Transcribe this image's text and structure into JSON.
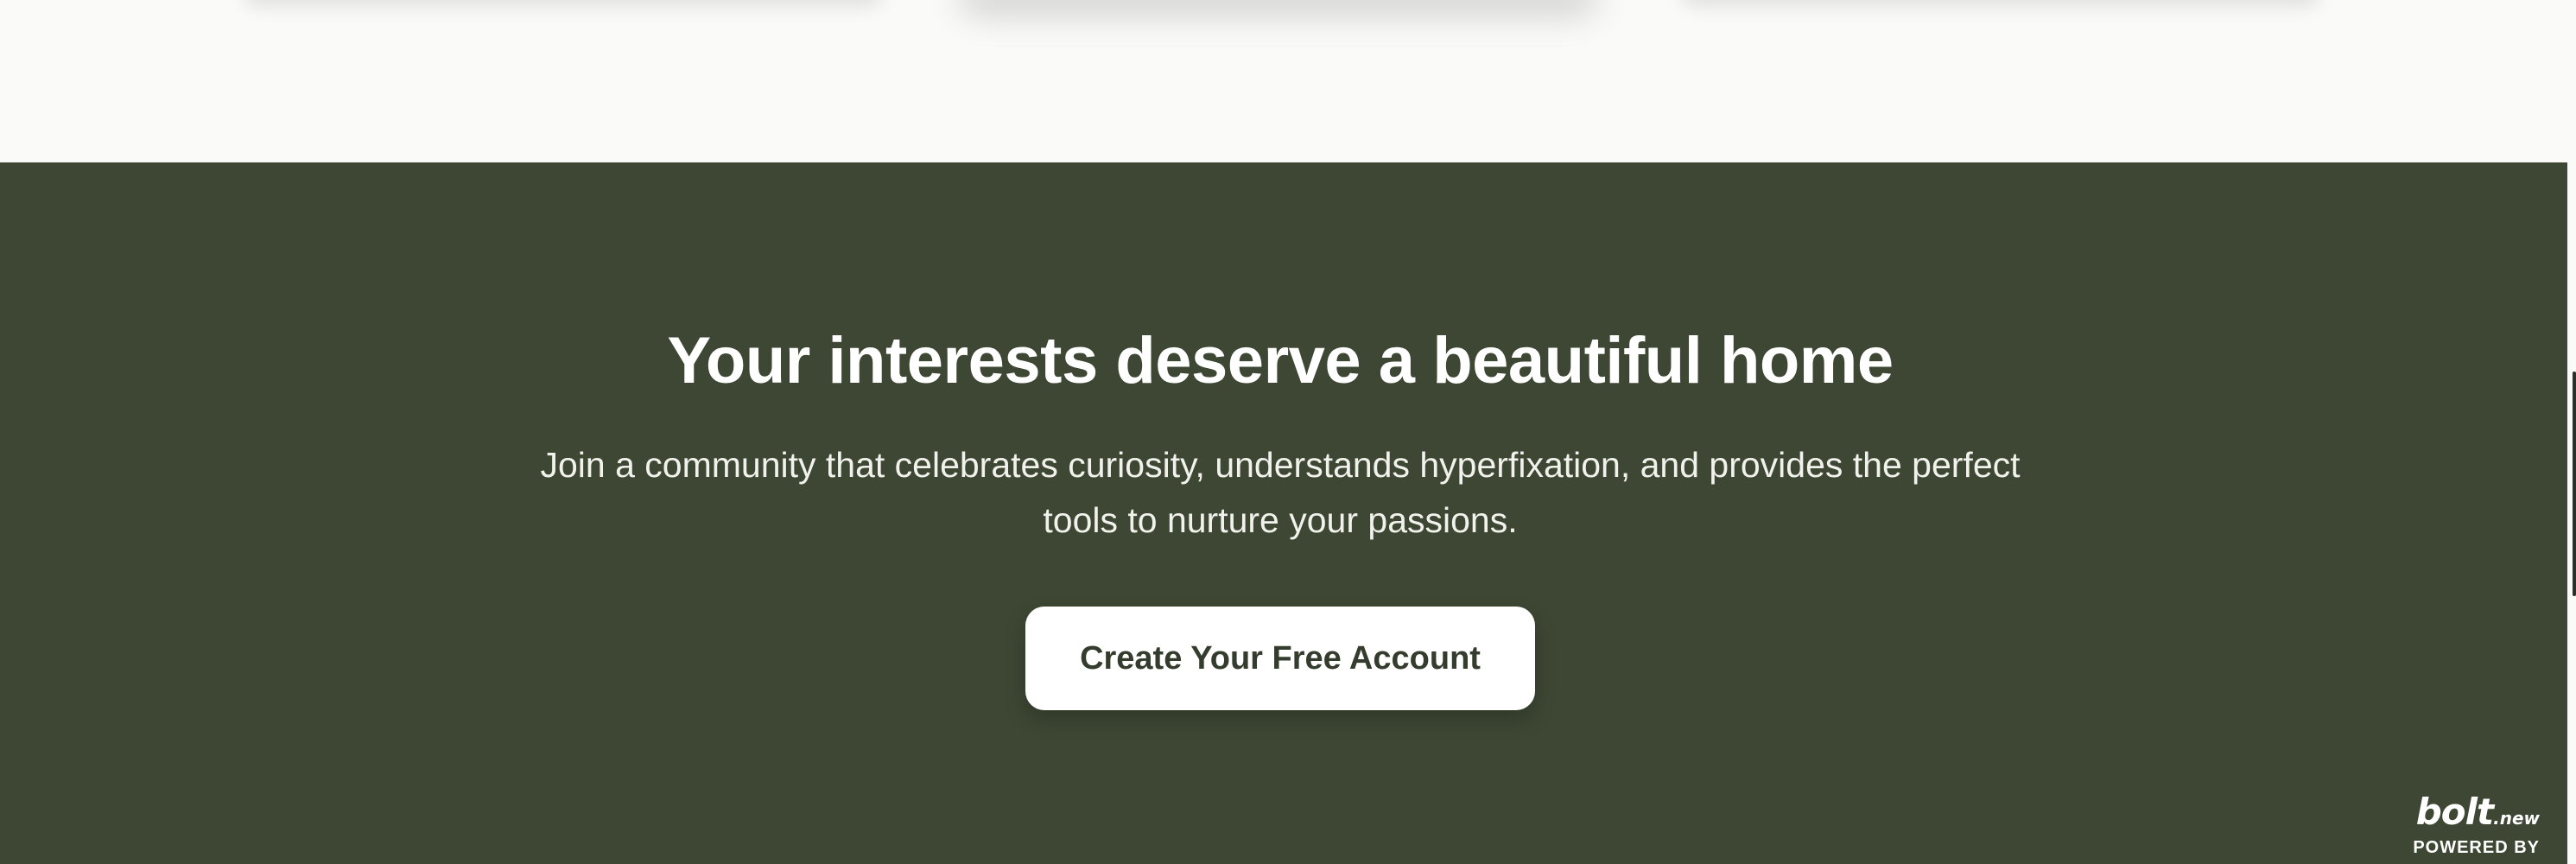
{
  "cta": {
    "title": "Your interests deserve a beautiful home",
    "subtitle": "Join a community that celebrates curiosity, understands hyperfixation, and provides the perfect tools to nurture your passions.",
    "button_label": "Create Your Free Account"
  },
  "badge": {
    "logo_main": "bolt",
    "logo_suffix": ".new",
    "caption": "POWERED BY"
  },
  "colors": {
    "cta_background": "#3d4733",
    "page_background": "#fafbf8",
    "button_background": "#ffffff",
    "button_text": "#343c2d"
  }
}
